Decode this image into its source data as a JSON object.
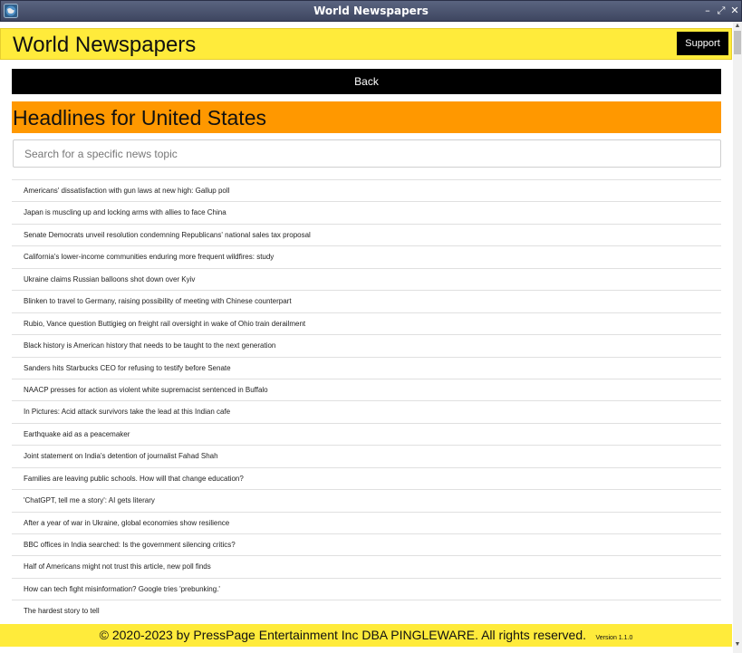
{
  "window": {
    "title": "World Newspapers",
    "controls": {
      "minimize": "–",
      "maximize": "⤢",
      "close": "✕"
    }
  },
  "header": {
    "title": "World Newspapers",
    "support_label": "Support"
  },
  "back_label": "Back",
  "section_heading": "Headlines for United States",
  "search": {
    "placeholder": "Search for a specific news topic",
    "value": ""
  },
  "headlines": [
    "Americans' dissatisfaction with gun laws at new high: Gallup poll",
    "Japan is muscling up and locking arms with allies to face China",
    "Senate Democrats unveil resolution condemning Republicans' national sales tax proposal",
    "California's lower-income communities enduring more frequent wildfires: study",
    "Ukraine claims Russian balloons shot down over Kyiv",
    "Blinken to travel to Germany, raising possibility of meeting with Chinese counterpart",
    "Rubio, Vance question Buttigieg on freight rail oversight in wake of Ohio train derailment",
    "Black history is American history that needs to be taught to the next generation",
    "Sanders hits Starbucks CEO for refusing to testify before Senate",
    "NAACP presses for action as violent white supremacist sentenced in Buffalo",
    "In Pictures: Acid attack survivors take the lead at this Indian cafe",
    "Earthquake aid as a peacemaker",
    "Joint statement on India's detention of journalist Fahad Shah",
    "Families are leaving public schools. How will that change education?",
    "'ChatGPT, tell me a story': AI gets literary",
    "After a year of war in Ukraine, global economies show resilience",
    "BBC offices in India searched: Is the government silencing critics?",
    "Half of Americans might not trust this article, new poll finds",
    "How can tech fight misinformation? Google tries 'prebunking.'",
    "The hardest story to tell"
  ],
  "footer": {
    "copyright": "© 2020-2023 by PressPage Entertainment Inc DBA PINGLEWARE. All rights reserved.",
    "version": "Version 1.1.0"
  },
  "colors": {
    "header_bg": "#ffeb3b",
    "heading_bg": "#ff9800",
    "button_bg": "#000000",
    "titlebar_bg": "#4a5370"
  }
}
